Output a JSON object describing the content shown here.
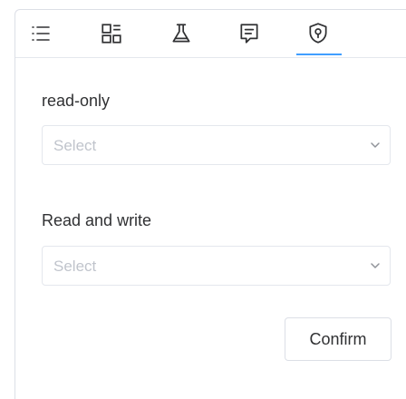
{
  "tabs": [
    {
      "icon": "list-icon"
    },
    {
      "icon": "dashboard-icon"
    },
    {
      "icon": "flask-icon"
    },
    {
      "icon": "message-icon"
    },
    {
      "icon": "shield-icon",
      "active": true
    }
  ],
  "colors": {
    "accent": "#409eff",
    "text": "#303133",
    "placeholder": "#c0c4cc",
    "border": "#e4e7ed",
    "icon": "#303133"
  },
  "fields": {
    "read_only": {
      "label": "read-only",
      "placeholder": "Select"
    },
    "read_write": {
      "label": "Read and write",
      "placeholder": "Select"
    }
  },
  "confirm_label": "Confirm"
}
